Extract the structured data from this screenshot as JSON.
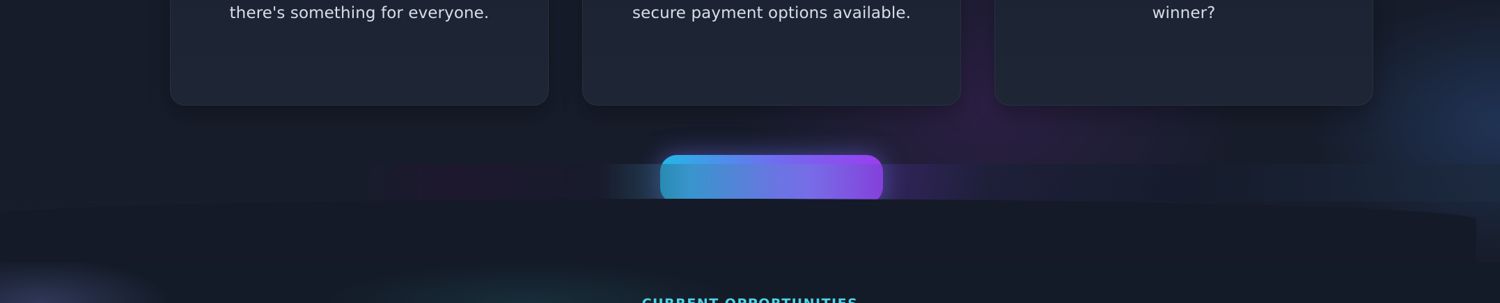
{
  "features": {
    "cards": [
      {
        "text": "there's something for everyone."
      },
      {
        "text": "secure payment options available."
      },
      {
        "text": "winner?"
      }
    ]
  },
  "section": {
    "eyebrow": "CURRENT OPPORTUNITIES"
  },
  "colors": {
    "background": "#151b29",
    "card": "#1d2534",
    "card_text": "#d8dde6",
    "accent_cyan": "#22b8e6",
    "accent_purple": "#9b3df0",
    "eyebrow": "#4fd6e8"
  }
}
